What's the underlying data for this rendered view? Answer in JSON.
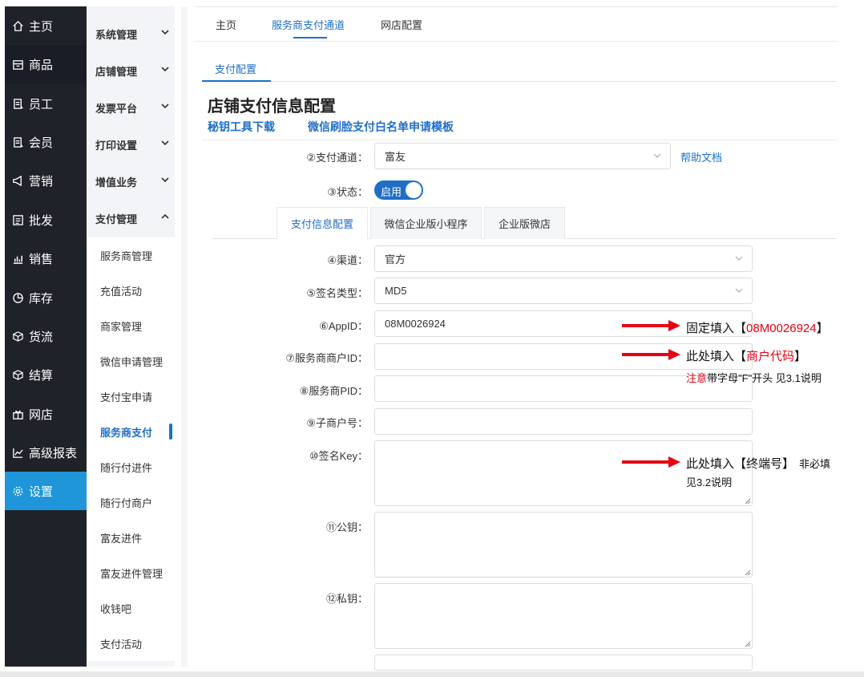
{
  "nav": {
    "items": [
      {
        "label": "主页",
        "icon": "home-icon"
      },
      {
        "label": "商品",
        "icon": "shop-icon"
      },
      {
        "label": "员工",
        "icon": "staff-icon"
      },
      {
        "label": "会员",
        "icon": "member-icon"
      },
      {
        "label": "营销",
        "icon": "megaphone-icon"
      },
      {
        "label": "批发",
        "icon": "list-icon"
      },
      {
        "label": "销售",
        "icon": "bar-chart-icon"
      },
      {
        "label": "库存",
        "icon": "clock-pie-icon"
      },
      {
        "label": "货流",
        "icon": "cube-icon"
      },
      {
        "label": "结算",
        "icon": "cube-icon"
      },
      {
        "label": "网店",
        "icon": "gift-icon"
      },
      {
        "label": "高级报表",
        "icon": "line-chart-icon"
      },
      {
        "label": "设置",
        "icon": "gear-icon"
      }
    ]
  },
  "subnav": {
    "groups": [
      "系统管理",
      "店铺管理",
      "发票平台",
      "打印设置",
      "增值业务",
      "支付管理"
    ],
    "items": [
      "服务商管理",
      "充值活动",
      "商家管理",
      "微信申请管理",
      "支付宝申请",
      "服务商支付",
      "随行付进件",
      "随行付商户",
      "富友进件",
      "富友进件管理",
      "收钱吧",
      "支付活动"
    ]
  },
  "topbar": {
    "tabs": [
      "主页",
      "服务商支付通道",
      "网店配置"
    ]
  },
  "subtabs": {
    "active": "支付配置"
  },
  "page": {
    "title": "店铺支付信息配置",
    "link_key_tool": "秘钥工具下载",
    "link_whitelist": "微信刷脸支付白名单申请模板"
  },
  "form": {
    "channel_label": "②支付通道：",
    "channel_value": "富友",
    "help_link": "帮助文档",
    "status_label": "③状态：",
    "status_value": "启用",
    "config_tabs": [
      "支付信息配置",
      "微信企业版小程序",
      "企业版微店"
    ],
    "route_label": "④渠道：",
    "route_value": "官方",
    "sign_type_label": "⑤签名类型：",
    "sign_type_value": "MD5",
    "appid_label": "⑥AppID：",
    "appid_value": "08M0026924",
    "merchant_id_label": "⑦服务商商户ID：",
    "pid_label": "⑧服务商PID：",
    "sub_merchant_label": "⑨子商户号：",
    "sign_key_label": "⑩签名Key：",
    "public_key_label": "⑪公钥：",
    "private_key_label": "⑫私钥："
  },
  "annotations": {
    "appid_prefix": "固定填入【",
    "appid_value": "08M0026924",
    "appid_suffix": "】",
    "merchant_prefix": "此处填入【",
    "merchant_value": "商户代码",
    "merchant_suffix": "】",
    "merchant_note_red": "注意",
    "merchant_note": "带字母\"F\"开头 见3.1说明",
    "signkey_main": "此处填入【终端号】",
    "signkey_optional": "非必填",
    "signkey_note": "见3.2说明"
  },
  "colors": {
    "nav_bg": "#20222a",
    "nav_active": "#1e96d9",
    "accent": "#1f6fc6",
    "annotation_red": "#e60012"
  }
}
